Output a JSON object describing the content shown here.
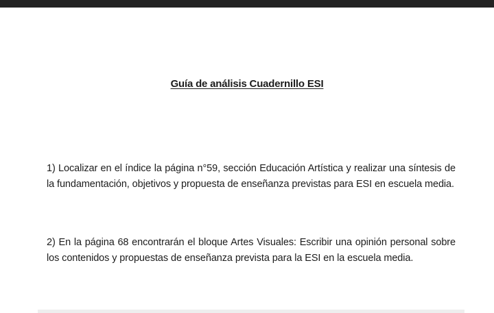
{
  "document": {
    "title": "Guía de análisis Cuadernillo ESI",
    "items": [
      {
        "text": "1) Localizar en el índice la página n°59, sección Educación Artística y realizar una síntesis de la fundamentación, objetivos y propuesta de enseñanza previstas para ESI en escuela media."
      },
      {
        "text": "2) En la página 68 encontrarán el bloque Artes Visuales: Escribir una opinión personal sobre los contenidos y propuestas de enseñanza prevista para la ESI en la escuela media."
      }
    ]
  },
  "colors": {
    "top_bar": "#232323",
    "page_background": "#ffffff",
    "text": "#1c1c1c"
  }
}
